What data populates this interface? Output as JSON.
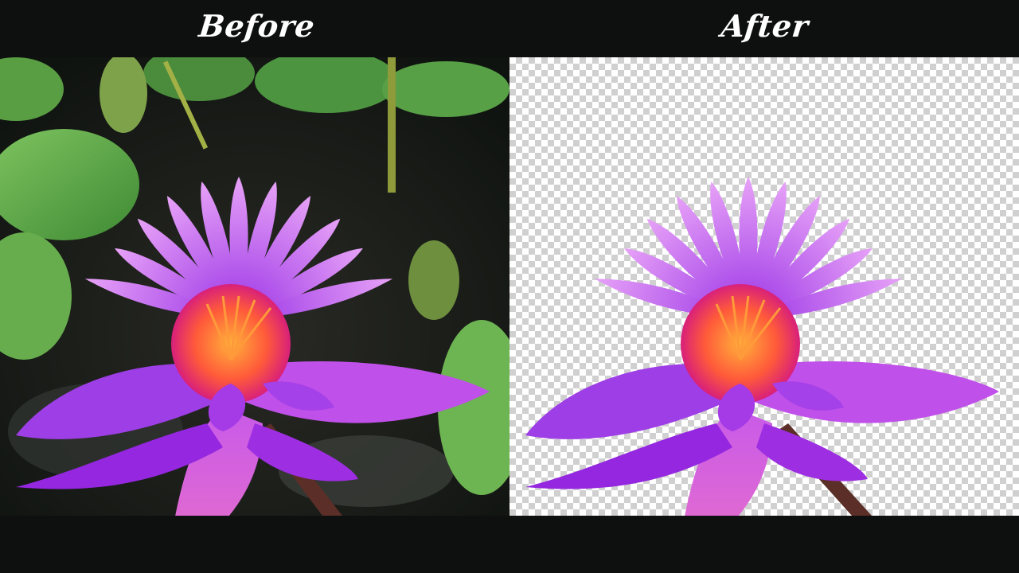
{
  "labels": {
    "before": "Before",
    "after": "After"
  },
  "colors": {
    "background": "#0e0f0f",
    "label_text": "#ffffff",
    "petal_main": "#b54ee8",
    "petal_light": "#e28af5",
    "petal_deep": "#8a2be2",
    "stamen_orange": "#ff7a2e",
    "stamen_red": "#e0205a",
    "leaf_green": "#5fa84a",
    "water_dark": "#141a14"
  },
  "images": {
    "before": "water-lily-photo-with-background",
    "after": "water-lily-cutout-on-transparent"
  }
}
